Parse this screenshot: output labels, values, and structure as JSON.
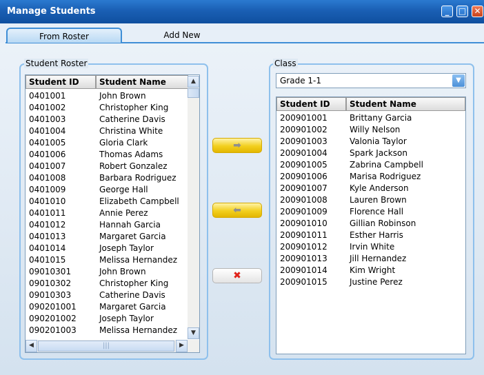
{
  "window": {
    "title": "Manage Students"
  },
  "tabs": [
    {
      "label": "From Roster"
    },
    {
      "label": "Add New"
    }
  ],
  "roster": {
    "label": "Student Roster",
    "columns": [
      "Student ID",
      "Student Name"
    ],
    "rows": [
      [
        "0401001",
        "John Brown"
      ],
      [
        "0401002",
        "Christopher  King"
      ],
      [
        "0401003",
        "Catherine Davis"
      ],
      [
        "0401004",
        "Christina White"
      ],
      [
        "0401005",
        "Gloria Clark"
      ],
      [
        "0401006",
        "Thomas Adams"
      ],
      [
        "0401007",
        "Robert Gonzalez"
      ],
      [
        "0401008",
        "Barbara Rodriguez"
      ],
      [
        "0401009",
        "George Hall"
      ],
      [
        "0401010",
        "Elizabeth Campbell"
      ],
      [
        "0401011",
        "Annie Perez"
      ],
      [
        "0401012",
        "Hannah Garcia"
      ],
      [
        "0401013",
        "Margaret Garcia"
      ],
      [
        "0401014",
        "Joseph Taylor"
      ],
      [
        "0401015",
        "Melissa Hernandez"
      ],
      [
        "09010301",
        "John Brown"
      ],
      [
        "09010302",
        "Christopher  King"
      ],
      [
        "09010303",
        "Catherine Davis"
      ],
      [
        "090201001",
        "Margaret Garcia"
      ],
      [
        "090201002",
        "Joseph Taylor"
      ],
      [
        "090201003",
        "Melissa Hernandez"
      ]
    ]
  },
  "class": {
    "label": "Class",
    "selected": "Grade 1-1",
    "columns": [
      "Student ID",
      "Student Name"
    ],
    "rows": [
      [
        "200901001",
        "Brittany Garcia"
      ],
      [
        "200901002",
        "Willy Nelson"
      ],
      [
        "200901003",
        "Valonia Taylor"
      ],
      [
        "200901004",
        "Spark Jackson"
      ],
      [
        "200901005",
        "Zabrina Campbell"
      ],
      [
        "200901006",
        "Marisa Rodriguez"
      ],
      [
        "200901007",
        "Kyle Anderson"
      ],
      [
        "200901008",
        "Lauren Brown"
      ],
      [
        "200901009",
        "Florence Hall"
      ],
      [
        "200901010",
        "Gillian Robinson"
      ],
      [
        "200901011",
        "Esther Harris"
      ],
      [
        "200901012",
        "Irvin White"
      ],
      [
        "200901013",
        "Jill  Hernandez"
      ],
      [
        "200901014",
        "Kim Wright"
      ],
      [
        "200901015",
        "Justine Perez"
      ]
    ]
  },
  "icons": {
    "minimize": "minimize-icon",
    "maximize": "maximize-icon",
    "close": "close-icon",
    "add": "arrow-right-icon",
    "remove": "arrow-left-icon",
    "delete": "delete-x-icon"
  }
}
